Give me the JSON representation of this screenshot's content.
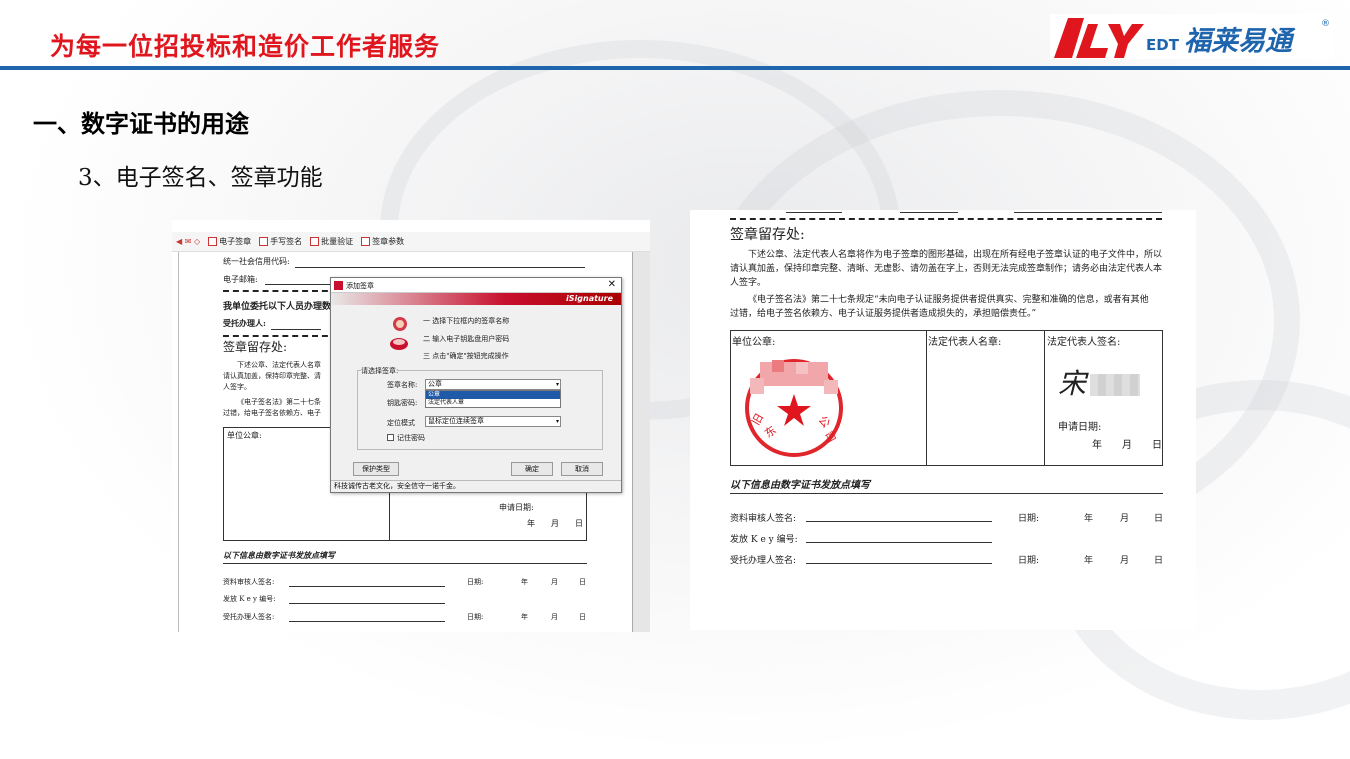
{
  "header": {
    "slogan": "为每一位招投标和造价工作者服务",
    "logo_text_latin": "EDT",
    "logo_text_cn": "福莱易通",
    "logo_registered": "®"
  },
  "section_title": "一、数字证书的用途",
  "subtitle": "3、电子签名、签章功能",
  "left_screenshot": {
    "toolbar": [
      "电子签章",
      "手写签名",
      "批量验证",
      "签章参数"
    ],
    "doc": {
      "credit_code_label": "统一社会信用代码:",
      "email_label": "电子邮箱:",
      "authorize_text": "我单位委托以下人员办理数",
      "agent_label": "受托办理人:",
      "seal_section": "签章留存处:",
      "para1": "下述公章、法定代表人名章",
      "para1b": "请认真加盖，保持印章完整、清",
      "para1c": "人签字。",
      "para2": "《电子签名法》第二十七条",
      "para2b": "过错，给电子签名依赖方、电子",
      "unit_seal": "单位公章:",
      "apply_date": "申请日期:",
      "ymd": "年　　月　　日",
      "issue_title": "以下信息由数字证书发放点填写",
      "reviewer": "资料审核人签名:",
      "key_no": "发放 K e y 编号:",
      "agent_sign": "受托办理人签名:",
      "date": "日期:",
      "y": "年",
      "m": "月",
      "d": "日"
    },
    "dialog": {
      "title": "添加签章",
      "brand": "iSignature",
      "step1": "一 选择下拉框内的签章名称",
      "step2": "二 输入电子钥匙盘用户密码",
      "step3": "三 点击\"确定\"按钮完成操作",
      "group_label": "请选择签章:",
      "seal_name_label": "签章名称:",
      "seal_name_value": "公章",
      "options": [
        "公章",
        "法定代表人章"
      ],
      "password_label": "钥匙密码:",
      "mode_label": "定位模式",
      "mode_value": "鼠标定位连续签章",
      "remember_label": "记住密码",
      "protect_btn": "保护类型",
      "ok_btn": "确定",
      "cancel_btn": "取消",
      "status": "科技诚传古老文化，安全信守一诺千金。"
    }
  },
  "right_screenshot": {
    "seal_section": "签章留存处:",
    "para1": "下述公章、法定代表人名章将作为电子签章的图形基础，出现在所有经电子签章认证的电子文件中，所以",
    "para1b": "请认真加盖，保持印章完整、清晰、无虚影、请勿盖在字上，否则无法完成签章制作；请务必由法定代表人本",
    "para1c": "人签字。",
    "para2": "《电子签名法》第二十七条规定“未向电子认证服务提供者提供真实、完整和准确的信息，或者有其他",
    "para2b": "过错，给电子签名依赖方、电子认证服务提供者造成损失的，承担赔偿责任。”",
    "col1": "单位公章:",
    "col2": "法定代表人名章:",
    "col3": "法定代表人签名:",
    "signature_char": "宋",
    "apply_date": "申请日期:",
    "ymd": "年　　月　　日",
    "issue_title": "以下信息由数字证书发放点填写",
    "reviewer": "资料审核人签名:",
    "key_no": "发放 K e y 编号:",
    "agent_sign": "受托办理人签名:",
    "date": "日期:",
    "y": "年",
    "m": "月",
    "d": "日"
  },
  "colors": {
    "brand_red": "#e0161e",
    "header_line": "#1f65ad",
    "logo_blue": "#1f65ad"
  }
}
